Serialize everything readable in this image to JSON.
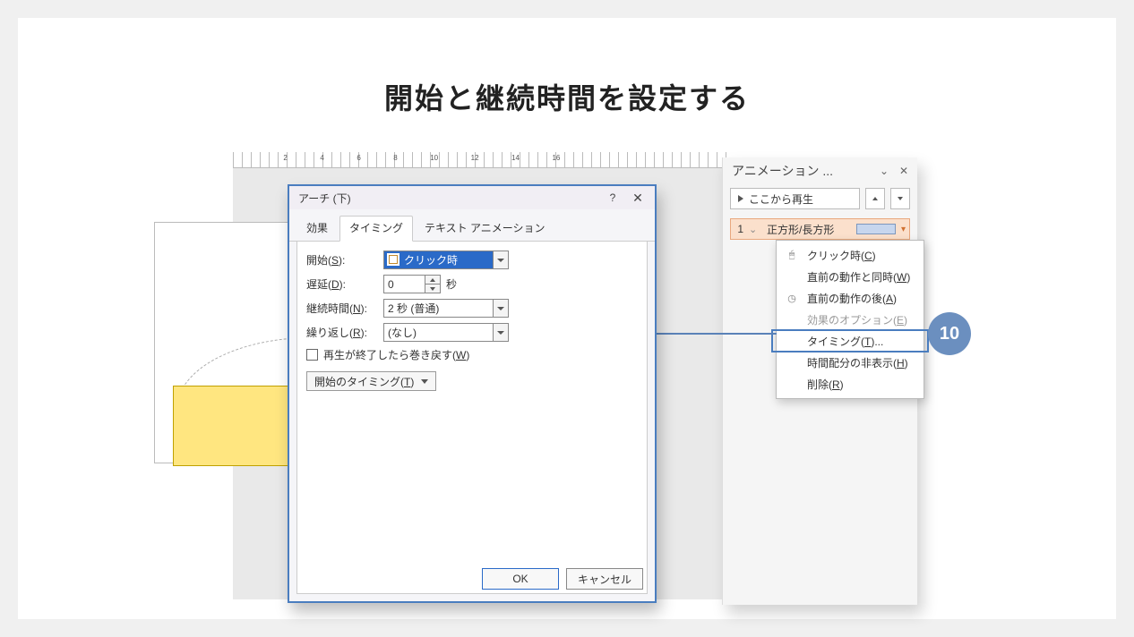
{
  "heading": "開始と継続時間を設定する",
  "ruler": [
    "4",
    "2",
    "",
    "2",
    "4",
    "6",
    "8",
    "10",
    "12",
    "14",
    "16"
  ],
  "dialog": {
    "title": "アーチ (下)",
    "tabs": {
      "effect": "効果",
      "timing": "タイミング",
      "text": "テキスト アニメーション"
    },
    "startLabel": "開始(",
    "startKey": "S",
    "startLabel2": "):",
    "startValue": "クリック時",
    "delayLabel": "遅延(",
    "delayKey": "D",
    "delayLabel2": "):",
    "delayValue": "0",
    "delayUnit": "秒",
    "durLabel": "継続時間(",
    "durKey": "N",
    "durLabel2": "):",
    "durValue": "2 秒 (普通)",
    "repLabel": "繰り返し(",
    "repKey": "R",
    "repLabel2": "):",
    "repValue": "(なし)",
    "rewind1": "再生が終了したら巻き戻す(",
    "rewindKey": "W",
    "rewind2": ")",
    "expand1": "開始のタイミング(",
    "expandKey": "T",
    "expand2": ")",
    "ok": "OK",
    "cancel": "キャンセル"
  },
  "pane": {
    "title": "アニメーション ...",
    "play": "ここから再生",
    "itemNum": "1",
    "itemName": "正方形/長方形"
  },
  "ctx": {
    "click1": "クリック時(",
    "clickKey": "C",
    "click2": ")",
    "with1": "直前の動作と同時(",
    "withKey": "W",
    "with2": ")",
    "after1": "直前の動作の後(",
    "afterKey": "A",
    "after2": ")",
    "opt1": "効果のオプション(",
    "optKey": "E",
    "opt2": ")",
    "timing1": "タイミング(",
    "timingKey": "T",
    "timing2": ")...",
    "hide1": "時間配分の非表示(",
    "hideKey": "H",
    "hide2": ")",
    "del1": "削除(",
    "delKey": "R",
    "del2": ")"
  },
  "badge": "10"
}
